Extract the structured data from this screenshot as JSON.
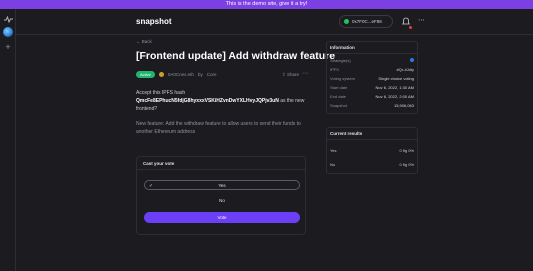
{
  "banner": {
    "text": "This is the demo site, give it a try!"
  },
  "rail": {
    "icons": [
      "activity-icon",
      "space-avatar",
      "plus-icon"
    ],
    "plus_glyph": "+"
  },
  "header": {
    "logo": "snapshot",
    "account": "0x7F0C...eF88",
    "icons": {
      "bell": "bell-icon",
      "more": "more-icon"
    },
    "more_glyph": "⋯"
  },
  "proposal": {
    "back_label": "Back",
    "title": "[Frontend update] Add withdraw feature",
    "status": "Active",
    "author": "0A0Cnes.eth",
    "author_tag": "Core",
    "author_prefix": "by",
    "share_label": "Share",
    "body_p1_prefix": "Accept this IPFS hash",
    "ipfs_hash": "QmcFe8EPhucN5fdjG8hyxxxVSKiHZvnDwYXLHvyJQPjv3uN",
    "body_p1_suffix": "as the new frontend?",
    "body_p2": "New feature: Add the withdraw feature to allow users to send their funds to another Ethereum address"
  },
  "vote": {
    "heading": "Cast your vote",
    "choices": [
      "Yes",
      "No"
    ],
    "selected": "Yes",
    "submit_label": "Vote",
    "check_glyph": "✓"
  },
  "information": {
    "heading": "Information",
    "rows": [
      {
        "label": "Strategie(s)",
        "value": ""
      },
      {
        "label": "IPFS",
        "value": "#Qr-4Jdty"
      },
      {
        "label": "Voting system",
        "value": "Single choice voting"
      },
      {
        "label": "Start date",
        "value": "Nov 6, 2022, 1:30 AM"
      },
      {
        "label": "End date",
        "value": "Nov 6, 2022, 2:00 AM"
      },
      {
        "label": "Snapshot",
        "value": "15,906,063"
      }
    ]
  },
  "results": {
    "heading": "Current results",
    "rows": [
      {
        "label": "Yes",
        "value": "0 flg",
        "pct": "0%"
      },
      {
        "label": "No",
        "value": "0 flg",
        "pct": "0%"
      }
    ]
  },
  "colors": {
    "accent": "#6a3ff6",
    "banner": "#7b3fe4",
    "active": "#21b66f",
    "bg": "#1c1b20"
  }
}
